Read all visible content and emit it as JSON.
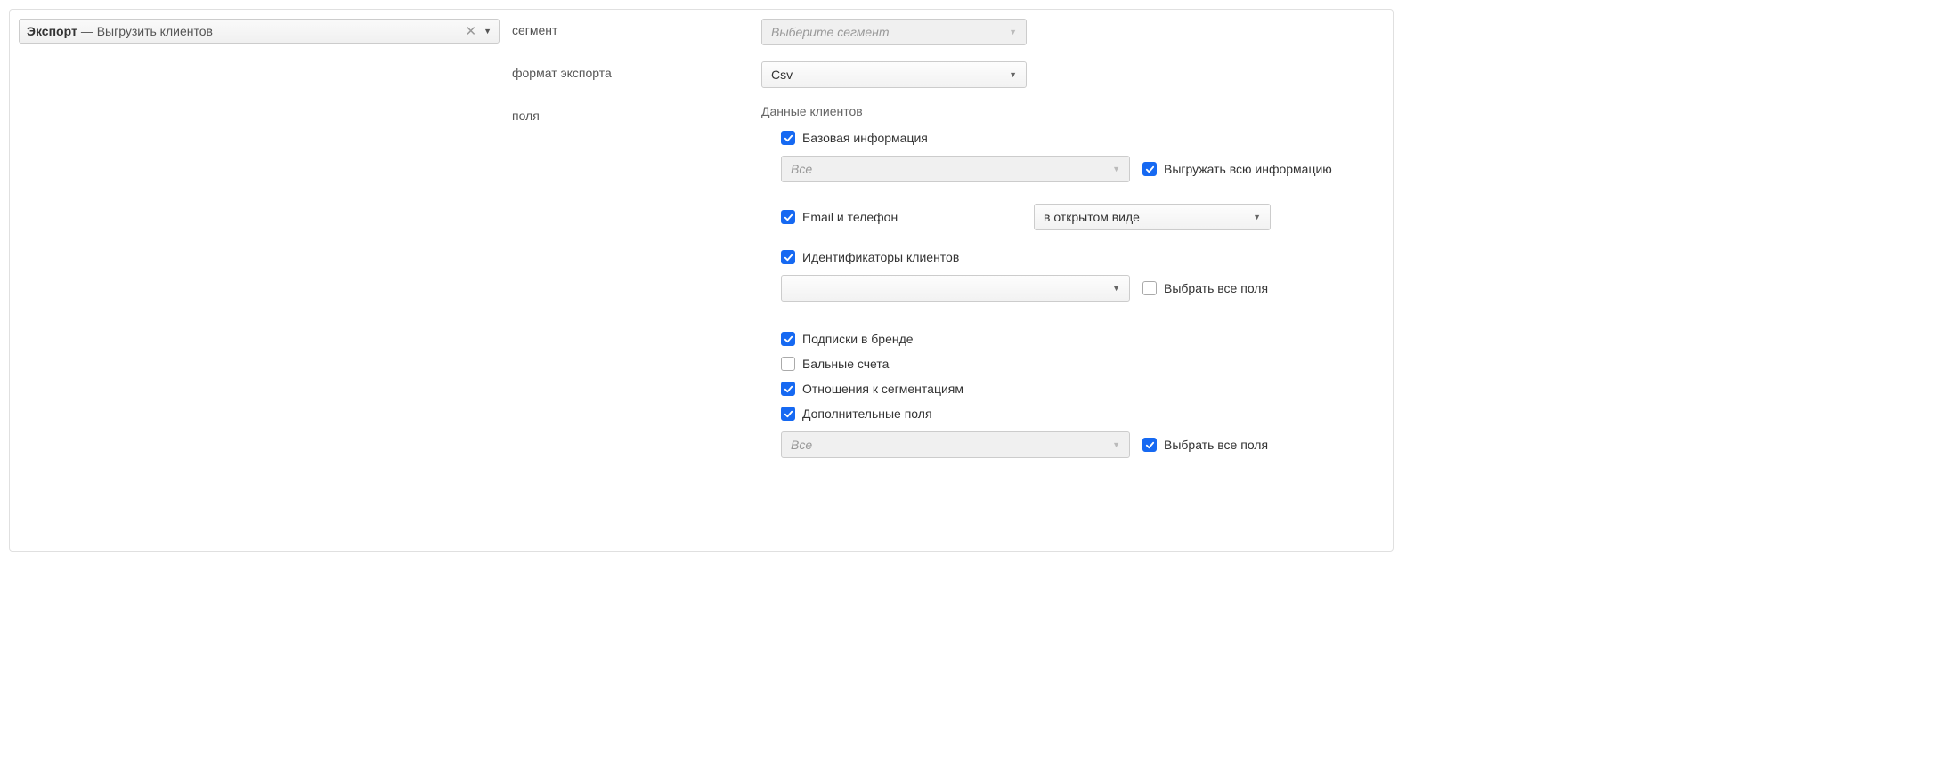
{
  "header": {
    "bold": "Экспорт",
    "rest": "— Выгрузить клиентов"
  },
  "labels": {
    "segment": "сегмент",
    "format": "формат экспорта",
    "fields": "поля"
  },
  "segment_select": {
    "placeholder": "Выберите сегмент"
  },
  "format_select": {
    "value": "Csv"
  },
  "fields": {
    "section_title": "Данные клиентов",
    "base_info": "Базовая информация",
    "base_select_value": "Все",
    "export_all_info": "Выгружать всю информацию",
    "email_phone": "Email и телефон",
    "email_phone_mode": "в открытом виде",
    "client_ids": "Идентификаторы клиентов",
    "client_ids_select_value": "",
    "select_all_fields": "Выбрать все поля",
    "brand_subs": "Подписки в бренде",
    "point_accounts": "Бальные счета",
    "segment_relations": "Отношения к сегментациям",
    "extra_fields": "Дополнительные поля",
    "extra_select_value": "Все",
    "extra_select_all": "Выбрать все поля"
  }
}
